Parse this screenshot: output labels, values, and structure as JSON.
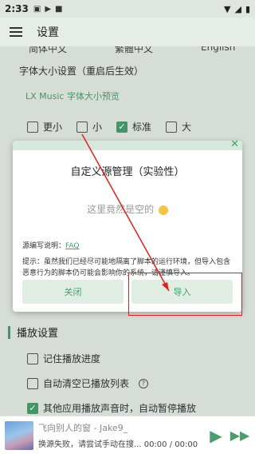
{
  "status_bar": {
    "time": "2:33"
  },
  "app_bar": {
    "title": "设置"
  },
  "language_row": [
    "简体中文",
    "繁體中文",
    "English"
  ],
  "font_section": {
    "label": "字体大小设置（重启后生效）",
    "preview": "LX Music 字体大小预览",
    "options": [
      {
        "label": "更小",
        "checked": false
      },
      {
        "label": "小",
        "checked": false
      },
      {
        "label": "标准",
        "checked": true
      },
      {
        "label": "大",
        "checked": false
      }
    ]
  },
  "dialog": {
    "title": "自定义源管理（实验性）",
    "empty_text": "这里竟然是空的",
    "rule_label": "源编写说明：",
    "rule_link": "FAQ",
    "tip": "提示：虽然我们已经尽可能地隔离了脚本的运行环境，但导入包含恶意行为的脚本仍可能会影响你的系统，请谨慎导入。",
    "cancel_label": "关闭",
    "import_label": "导入"
  },
  "play_section": {
    "title": "播放设置",
    "items": [
      {
        "label": "记住播放进度",
        "checked": false
      },
      {
        "label": "自动清空已播放列表",
        "checked": false
      },
      {
        "label": "其他应用播放声音时，自动暂停播放",
        "checked": true
      }
    ]
  },
  "player": {
    "title": "飞向别人的窗 - Jake9_",
    "status": "换源失败，请尝试手动在搜... 00:00 / 00:00"
  },
  "colors": {
    "accent": "#4a9e6c",
    "annotation": "#e02020"
  }
}
